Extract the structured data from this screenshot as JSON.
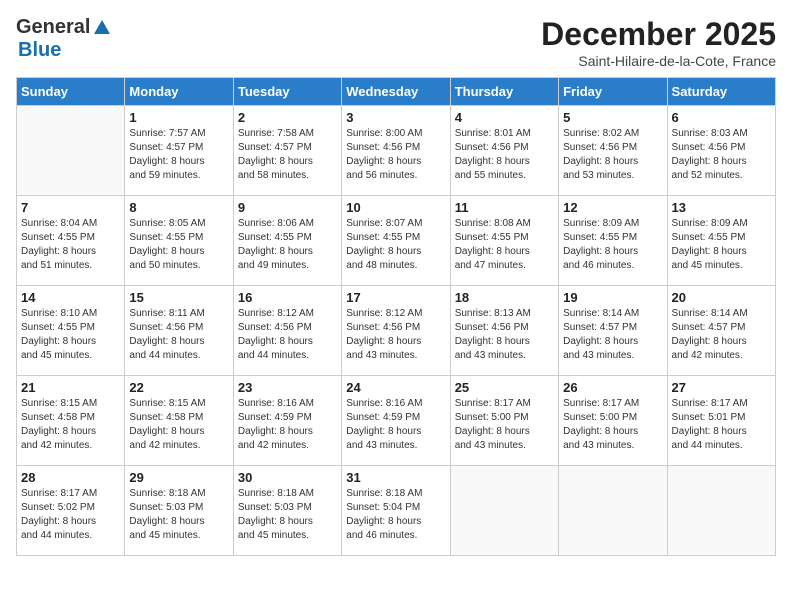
{
  "logo": {
    "general": "General",
    "blue": "Blue"
  },
  "title": {
    "month": "December 2025",
    "location": "Saint-Hilaire-de-la-Cote, France"
  },
  "weekdays": [
    "Sunday",
    "Monday",
    "Tuesday",
    "Wednesday",
    "Thursday",
    "Friday",
    "Saturday"
  ],
  "weeks": [
    [
      {
        "day": "",
        "info": ""
      },
      {
        "day": "1",
        "info": "Sunrise: 7:57 AM\nSunset: 4:57 PM\nDaylight: 8 hours\nand 59 minutes."
      },
      {
        "day": "2",
        "info": "Sunrise: 7:58 AM\nSunset: 4:57 PM\nDaylight: 8 hours\nand 58 minutes."
      },
      {
        "day": "3",
        "info": "Sunrise: 8:00 AM\nSunset: 4:56 PM\nDaylight: 8 hours\nand 56 minutes."
      },
      {
        "day": "4",
        "info": "Sunrise: 8:01 AM\nSunset: 4:56 PM\nDaylight: 8 hours\nand 55 minutes."
      },
      {
        "day": "5",
        "info": "Sunrise: 8:02 AM\nSunset: 4:56 PM\nDaylight: 8 hours\nand 53 minutes."
      },
      {
        "day": "6",
        "info": "Sunrise: 8:03 AM\nSunset: 4:56 PM\nDaylight: 8 hours\nand 52 minutes."
      }
    ],
    [
      {
        "day": "7",
        "info": "Sunrise: 8:04 AM\nSunset: 4:55 PM\nDaylight: 8 hours\nand 51 minutes."
      },
      {
        "day": "8",
        "info": "Sunrise: 8:05 AM\nSunset: 4:55 PM\nDaylight: 8 hours\nand 50 minutes."
      },
      {
        "day": "9",
        "info": "Sunrise: 8:06 AM\nSunset: 4:55 PM\nDaylight: 8 hours\nand 49 minutes."
      },
      {
        "day": "10",
        "info": "Sunrise: 8:07 AM\nSunset: 4:55 PM\nDaylight: 8 hours\nand 48 minutes."
      },
      {
        "day": "11",
        "info": "Sunrise: 8:08 AM\nSunset: 4:55 PM\nDaylight: 8 hours\nand 47 minutes."
      },
      {
        "day": "12",
        "info": "Sunrise: 8:09 AM\nSunset: 4:55 PM\nDaylight: 8 hours\nand 46 minutes."
      },
      {
        "day": "13",
        "info": "Sunrise: 8:09 AM\nSunset: 4:55 PM\nDaylight: 8 hours\nand 45 minutes."
      }
    ],
    [
      {
        "day": "14",
        "info": "Sunrise: 8:10 AM\nSunset: 4:55 PM\nDaylight: 8 hours\nand 45 minutes."
      },
      {
        "day": "15",
        "info": "Sunrise: 8:11 AM\nSunset: 4:56 PM\nDaylight: 8 hours\nand 44 minutes."
      },
      {
        "day": "16",
        "info": "Sunrise: 8:12 AM\nSunset: 4:56 PM\nDaylight: 8 hours\nand 44 minutes."
      },
      {
        "day": "17",
        "info": "Sunrise: 8:12 AM\nSunset: 4:56 PM\nDaylight: 8 hours\nand 43 minutes."
      },
      {
        "day": "18",
        "info": "Sunrise: 8:13 AM\nSunset: 4:56 PM\nDaylight: 8 hours\nand 43 minutes."
      },
      {
        "day": "19",
        "info": "Sunrise: 8:14 AM\nSunset: 4:57 PM\nDaylight: 8 hours\nand 43 minutes."
      },
      {
        "day": "20",
        "info": "Sunrise: 8:14 AM\nSunset: 4:57 PM\nDaylight: 8 hours\nand 42 minutes."
      }
    ],
    [
      {
        "day": "21",
        "info": "Sunrise: 8:15 AM\nSunset: 4:58 PM\nDaylight: 8 hours\nand 42 minutes."
      },
      {
        "day": "22",
        "info": "Sunrise: 8:15 AM\nSunset: 4:58 PM\nDaylight: 8 hours\nand 42 minutes."
      },
      {
        "day": "23",
        "info": "Sunrise: 8:16 AM\nSunset: 4:59 PM\nDaylight: 8 hours\nand 42 minutes."
      },
      {
        "day": "24",
        "info": "Sunrise: 8:16 AM\nSunset: 4:59 PM\nDaylight: 8 hours\nand 43 minutes."
      },
      {
        "day": "25",
        "info": "Sunrise: 8:17 AM\nSunset: 5:00 PM\nDaylight: 8 hours\nand 43 minutes."
      },
      {
        "day": "26",
        "info": "Sunrise: 8:17 AM\nSunset: 5:00 PM\nDaylight: 8 hours\nand 43 minutes."
      },
      {
        "day": "27",
        "info": "Sunrise: 8:17 AM\nSunset: 5:01 PM\nDaylight: 8 hours\nand 44 minutes."
      }
    ],
    [
      {
        "day": "28",
        "info": "Sunrise: 8:17 AM\nSunset: 5:02 PM\nDaylight: 8 hours\nand 44 minutes."
      },
      {
        "day": "29",
        "info": "Sunrise: 8:18 AM\nSunset: 5:03 PM\nDaylight: 8 hours\nand 45 minutes."
      },
      {
        "day": "30",
        "info": "Sunrise: 8:18 AM\nSunset: 5:03 PM\nDaylight: 8 hours\nand 45 minutes."
      },
      {
        "day": "31",
        "info": "Sunrise: 8:18 AM\nSunset: 5:04 PM\nDaylight: 8 hours\nand 46 minutes."
      },
      {
        "day": "",
        "info": ""
      },
      {
        "day": "",
        "info": ""
      },
      {
        "day": "",
        "info": ""
      }
    ]
  ]
}
